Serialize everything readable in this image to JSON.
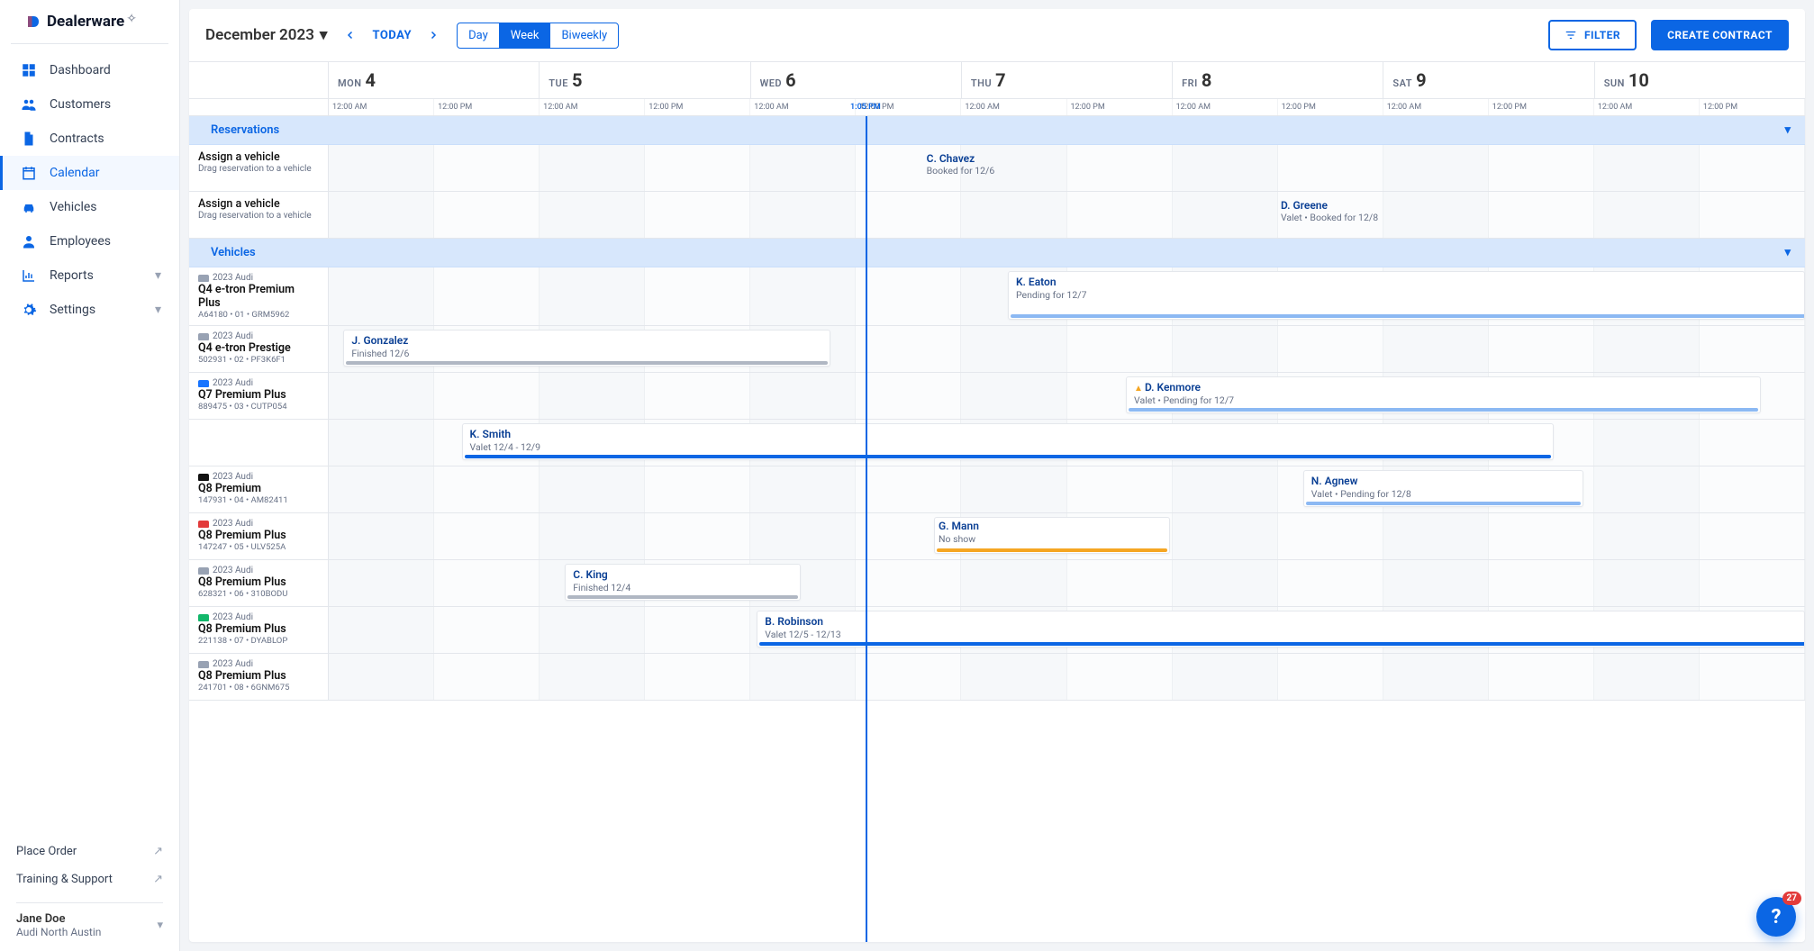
{
  "brand": {
    "name": "Dealerware",
    "plus": "✧"
  },
  "nav": [
    {
      "key": "dashboard",
      "label": "Dashboard",
      "icon": "grid"
    },
    {
      "key": "customers",
      "label": "Customers",
      "icon": "people"
    },
    {
      "key": "contracts",
      "label": "Contracts",
      "icon": "document"
    },
    {
      "key": "calendar",
      "label": "Calendar",
      "icon": "calendar",
      "active": true
    },
    {
      "key": "vehicles",
      "label": "Vehicles",
      "icon": "car"
    },
    {
      "key": "employees",
      "label": "Employees",
      "icon": "person"
    },
    {
      "key": "reports",
      "label": "Reports",
      "icon": "chart",
      "expandable": true
    },
    {
      "key": "settings",
      "label": "Settings",
      "icon": "gear",
      "expandable": true
    }
  ],
  "bottom_links": [
    {
      "key": "place-order",
      "label": "Place Order"
    },
    {
      "key": "training-support",
      "label": "Training & Support"
    }
  ],
  "user": {
    "name": "Jane Doe",
    "location": "Audi North Austin"
  },
  "toolbar": {
    "month_label": "December 2023",
    "today": "TODAY",
    "views": [
      "Day",
      "Week",
      "Biweekly"
    ],
    "active_view": "Week",
    "filter": "FILTER",
    "create": "CREATE CONTRACT"
  },
  "days": [
    {
      "dow": "MON",
      "num": "4"
    },
    {
      "dow": "TUE",
      "num": "5"
    },
    {
      "dow": "WED",
      "num": "6"
    },
    {
      "dow": "THU",
      "num": "7"
    },
    {
      "dow": "FRI",
      "num": "8"
    },
    {
      "dow": "SAT",
      "num": "9"
    },
    {
      "dow": "SUN",
      "num": "10"
    }
  ],
  "time_slots": [
    "12:00 AM",
    "12:00 PM"
  ],
  "now": {
    "label": "1:05 PM",
    "day_index": 2,
    "fraction_of_day": 0.545
  },
  "sections": {
    "reservations_label": "Reservations",
    "vehicles_label": "Vehicles"
  },
  "assign_row": {
    "title": "Assign a vehicle",
    "hint": "Drag reservation to a vehicle"
  },
  "vehicles": [
    {
      "year_make": "2023 Audi",
      "model": "Q4 e-tron Premium Plus",
      "meta": "A64180 • 01 • GRM5962",
      "car_color": "grey"
    },
    {
      "year_make": "2023 Audi",
      "model": "Q4 e-tron Prestige",
      "meta": "502931 • 02 • PF3K6F1",
      "car_color": "grey"
    },
    {
      "year_make": "2023 Audi",
      "model": "Q7 Premium Plus",
      "meta": "889475 • 03 • CUTP054",
      "car_color": "blue"
    },
    {
      "year_make": "2023 Audi",
      "model": "Q8 Premium",
      "meta": "147931 • 04 • AM82411",
      "car_color": "black"
    },
    {
      "year_make": "2023 Audi",
      "model": "Q8 Premium Plus",
      "meta": "147247 • 05 • ULV525A",
      "car_color": "red"
    },
    {
      "year_make": "2023 Audi",
      "model": "Q8 Premium Plus",
      "meta": "628321 • 06 • 310BODU",
      "car_color": "grey"
    },
    {
      "year_make": "2023 Audi",
      "model": "Q8 Premium Plus",
      "meta": "221138 • 07 • DYABLOP",
      "car_color": "green"
    },
    {
      "year_make": "2023 Audi",
      "model": "Q8 Premium Plus",
      "meta": "241701 • 08 • 6GNM675",
      "car_color": "grey"
    }
  ],
  "cards": {
    "res1": {
      "name": "C. Chavez",
      "desc": "Booked for 12/6"
    },
    "res2": {
      "name": "D. Greene",
      "desc": "Valet • Booked for 12/8"
    },
    "v0": {
      "name": "K. Eaton",
      "desc": "Pending for 12/7"
    },
    "v1": {
      "name": "J. Gonzalez",
      "desc": "Finished 12/6"
    },
    "v2": {
      "name": "D. Kenmore",
      "desc": "Valet • Pending for 12/7"
    },
    "v2b": {
      "name": "K. Smith",
      "desc": "Valet 12/4 - 12/9"
    },
    "v3": {
      "name": "N. Agnew",
      "desc": "Valet • Pending for 12/8"
    },
    "v4": {
      "name": "G. Mann",
      "desc": "No show"
    },
    "v5": {
      "name": "C. King",
      "desc": "Finished 12/4"
    },
    "v6": {
      "name": "B. Robinson",
      "desc": "Valet 12/5 - 12/13"
    }
  },
  "help_badge": "27"
}
